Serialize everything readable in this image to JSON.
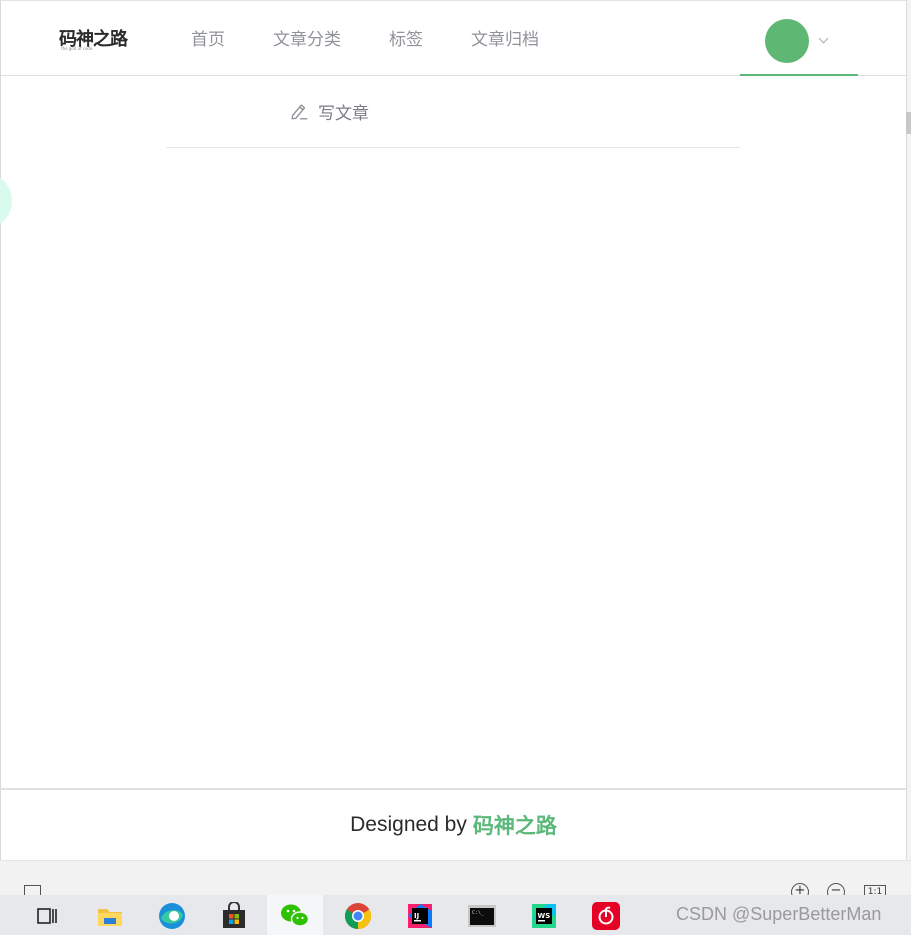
{
  "header": {
    "logo_text": "码神之路",
    "logo_sub": "the god of code",
    "nav": [
      {
        "label": "首页"
      },
      {
        "label": "文章分类"
      },
      {
        "label": "标签"
      },
      {
        "label": "文章归档"
      }
    ]
  },
  "submenu": {
    "write_label": "写文章"
  },
  "footer": {
    "prefix": "Designed by",
    "brand": "码神之路"
  },
  "toolbar": {
    "zoom_in": "+",
    "zoom_out": "−",
    "fit": "1:1"
  },
  "watermark": "CSDN @SuperBetterMan",
  "colors": {
    "accent": "#5cb87a",
    "avatar": "#5eb874",
    "nav_text": "#909399"
  },
  "taskbar_icons": [
    "task-view-icon",
    "file-explorer-icon",
    "edge-icon",
    "store-icon",
    "wechat-icon",
    "chrome-icon",
    "intellij-icon",
    "terminal-icon",
    "webstorm-icon",
    "netease-music-icon"
  ]
}
